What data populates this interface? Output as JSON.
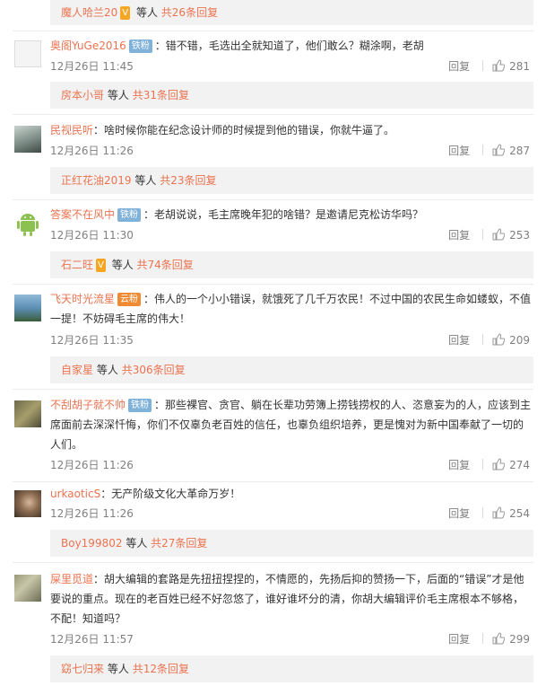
{
  "top_sub": {
    "name": "魔人哈兰20",
    "etc": "等人",
    "more": "共26条回复"
  },
  "comments": [
    {
      "user": "奥阁YuGe2016",
      "badge": "铁粉",
      "vip": "",
      "text": "错不错，毛选出全就知道了，他们敢么？糊涂啊，老胡",
      "date": "12月26日 11:45",
      "reply_label": "回复",
      "likes": "281",
      "sub": {
        "name": "房本小哥",
        "etc": "等人",
        "more": "共31条回复"
      }
    },
    {
      "user": "民视民听",
      "badge": "",
      "vip": "",
      "text": "啥时候你能在纪念设计师的时候提到他的错误，你就牛逼了。",
      "date": "12月26日 11:26",
      "reply_label": "回复",
      "likes": "287",
      "sub": {
        "name": "正红花油2019",
        "etc": "等人",
        "more": "共23条回复"
      }
    },
    {
      "user": "答案不在风中",
      "badge": "铁粉",
      "vip": "",
      "text": "老胡说说，毛主席晚年犯的啥错？是邀请尼克松访华吗？",
      "date": "12月26日 11:30",
      "reply_label": "回复",
      "likes": "253",
      "sub": {
        "name": "石二旺",
        "etc": "等人",
        "more": "共74条回复"
      }
    },
    {
      "user": "飞天时光流星",
      "badge": "",
      "vip": "云粉",
      "text": "伟人的一个小小错误，就饿死了几千万农民！不过中国的农民生命如蝼蚁，不值一提！不妨碍毛主席的伟大！",
      "date": "12月26日 11:35",
      "reply_label": "回复",
      "likes": "209",
      "sub": {
        "name": "自家星",
        "etc": "等人",
        "more": "共306条回复"
      }
    },
    {
      "user": "不刮胡子就不帅",
      "badge": "铁粉",
      "vip": "",
      "text": "那些裸官、贪官、躺在长辈功劳簿上捞钱捞权的人、恣意妄为的人，应该到主席面前去深深忏悔，你们不仅辜负老百姓的信任，也辜负组织培养，更是愧对为新中国奉献了一切的人们。",
      "date": "12月26日 11:26",
      "reply_label": "回复",
      "likes": "274",
      "sub": null
    },
    {
      "user": "urkaoticS",
      "badge": "",
      "vip": "",
      "text": "无产阶级文化大革命万岁！",
      "date": "12月26日 11:26",
      "reply_label": "回复",
      "likes": "254",
      "sub": {
        "name": "Boy199802",
        "etc": "等人",
        "more": "共27条回复"
      }
    },
    {
      "user": "屎里觅道",
      "badge": "",
      "vip": "",
      "text": "胡大编辑的套路是先扭扭捏捏的，不情愿的，先扬后抑的赞扬一下，后面的“错误”才是他要说的重点。现在的老百姓已经不好忽悠了，谁好谁坏分的清，你胡大编辑评价毛主席根本不够格，不配！知道吗？",
      "date": "12月26日 11:57",
      "reply_label": "回复",
      "likes": "299",
      "sub": {
        "name": "窈七归来",
        "etc": "等人",
        "more": "共12条回复"
      }
    }
  ]
}
